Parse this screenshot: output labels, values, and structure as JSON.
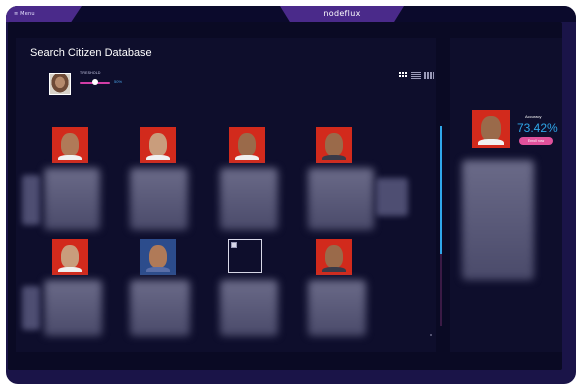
{
  "topbar": {
    "menu_label": "≡ Menu",
    "brand": "nodeflux"
  },
  "main": {
    "title": "Search Citizen Database",
    "threshold_label": "TRESHOLD",
    "threshold_value": "50%",
    "view_icons": [
      "grid-icon",
      "list-icon",
      "columns-icon"
    ]
  },
  "results": {
    "row1": [
      "face-1",
      "face-2",
      "face-3",
      "face-4"
    ],
    "row2": [
      "face-5",
      "face-6",
      "broken-image",
      "face-8"
    ]
  },
  "detail": {
    "accuracy_label": "Accuracy",
    "accuracy_value": "73.42%",
    "enroll_label": "Enroll now"
  },
  "colors": {
    "frame": "#1a1448",
    "tab": "#4a2a8a",
    "accent_blue": "#2fa6e8",
    "accent_pink": "#e0519b",
    "card_red": "#d22a1c"
  }
}
